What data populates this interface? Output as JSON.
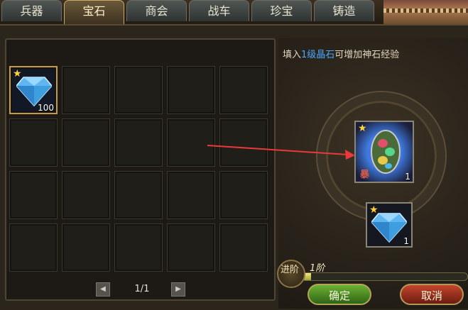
{
  "tabs": [
    "兵器",
    "宝石",
    "商会",
    "战车",
    "珍宝",
    "铸造"
  ],
  "active_tab": "宝石",
  "hint": {
    "prefix": "填入",
    "highlight": "1级晶石",
    "suffix": "可增加神石经验"
  },
  "inventory": {
    "items": [
      {
        "name": "blue-crystal-gem",
        "quantity": "100",
        "stars": "★"
      }
    ]
  },
  "pager": {
    "text": "1/1",
    "prev_icon": "arrow-left-icon",
    "next_icon": "arrow-right-icon"
  },
  "target_gem": {
    "name": "rainbow-divine-stone",
    "quantity": "1",
    "corner_label": "暴",
    "stars": "★"
  },
  "material_gem": {
    "name": "blue-crystal-gem",
    "quantity": "1",
    "stars": "★"
  },
  "advance": {
    "label": "进阶",
    "level": "1阶",
    "progress_fraction": 0.06
  },
  "buttons": {
    "confirm": "确定",
    "cancel": "取消"
  },
  "colors": {
    "hint_highlight": "#49a8ff",
    "confirm": "#4f8f24",
    "cancel": "#a0321e",
    "slot_border_selected": "#c79a45"
  }
}
